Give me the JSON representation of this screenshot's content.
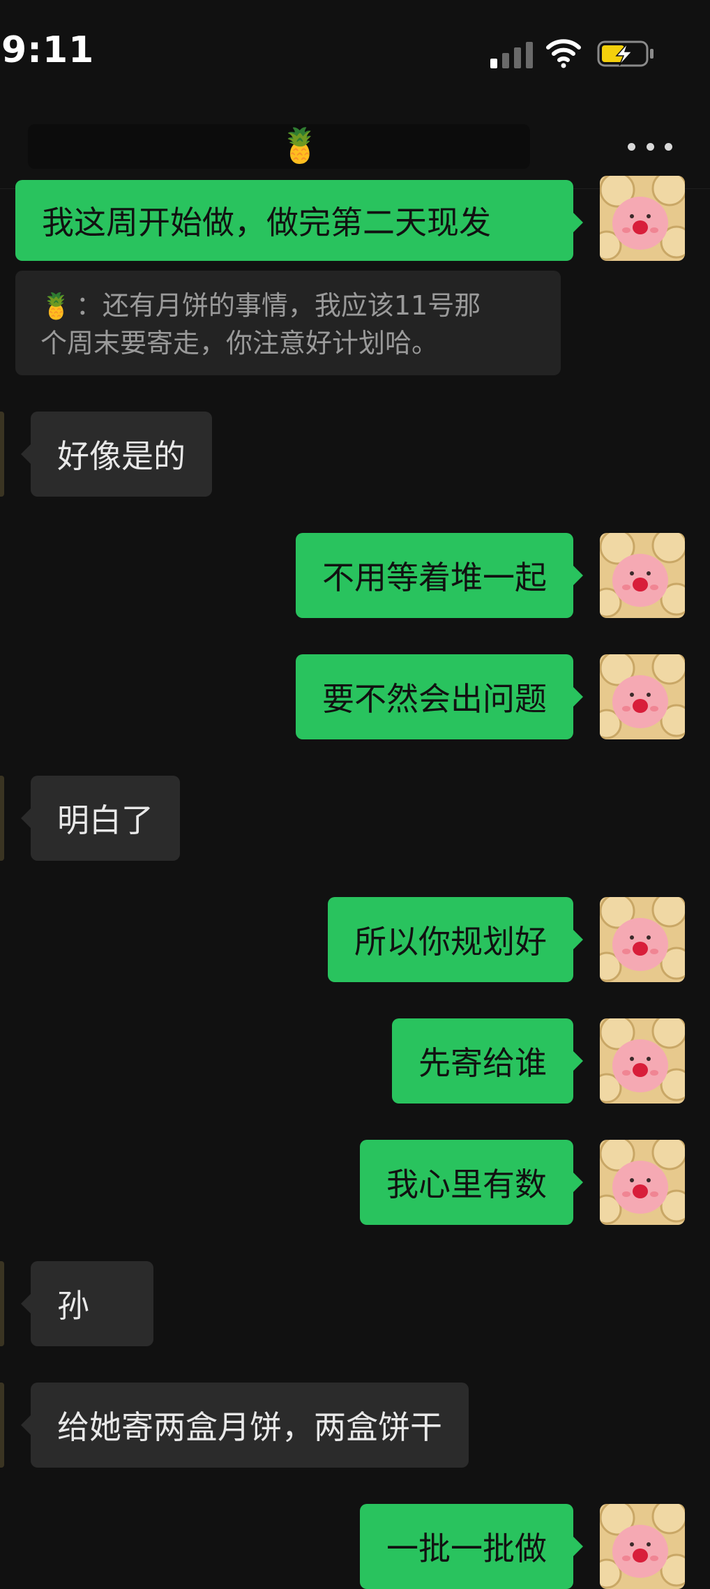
{
  "status_bar": {
    "time": "9:11"
  },
  "header": {
    "title_emoji": "🍍"
  },
  "quote": {
    "emoji": "🍍",
    "separator": "：",
    "line1": "还有月饼的事情，我应该11号那",
    "line2": "个周末要寄走，你注意好计划哈。"
  },
  "messages": [
    {
      "from": "me",
      "text": "我这周开始做，做完第二天现发"
    },
    {
      "from": "other",
      "text": "好像是的"
    },
    {
      "from": "me",
      "text": "不用等着堆一起"
    },
    {
      "from": "me",
      "text": "要不然会出问题"
    },
    {
      "from": "other",
      "text": "明白了"
    },
    {
      "from": "me",
      "text": "所以你规划好"
    },
    {
      "from": "me",
      "text": "先寄给谁"
    },
    {
      "from": "me",
      "text": "我心里有数"
    },
    {
      "from": "other",
      "text": "孙"
    },
    {
      "from": "other",
      "text": "给她寄两盒月饼，两盒饼干"
    },
    {
      "from": "me",
      "text": "一批一批做"
    }
  ],
  "colors": {
    "background": "#111111",
    "sent_bubble": "#29c35e",
    "received_bubble": "#2b2b2b",
    "quote_bg": "#232323"
  },
  "icons": [
    "signal-icon",
    "wifi-icon",
    "battery-charging-icon",
    "more-icon",
    "pineapple-emoji",
    "avatar-pink-creature"
  ]
}
